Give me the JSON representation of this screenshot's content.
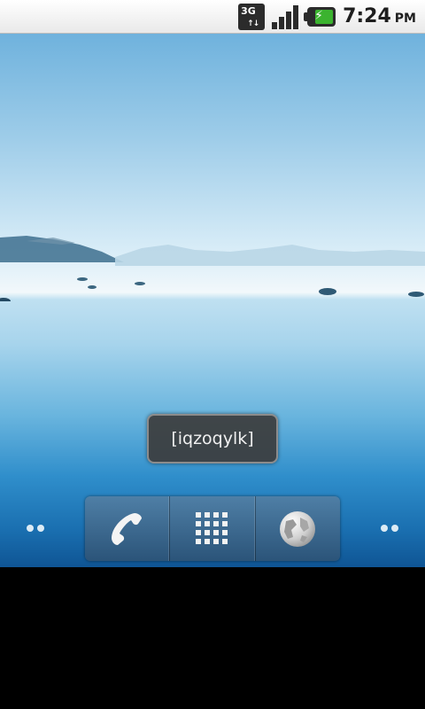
{
  "status_bar": {
    "network_type": "3G",
    "time": "7:24",
    "ampm": "PM",
    "icons": [
      "network-3g-icon",
      "signal-strength-icon",
      "battery-charging-icon"
    ]
  },
  "toast": {
    "text": "[iqzoqylk]"
  },
  "dock": {
    "buttons": [
      {
        "name": "phone-button",
        "icon": "phone-icon"
      },
      {
        "name": "app-drawer-button",
        "icon": "grid-icon"
      },
      {
        "name": "browser-button",
        "icon": "globe-icon"
      }
    ]
  },
  "colors": {
    "sky_top": "#6fb2dd",
    "horizon": "#f2f8fb",
    "water_deep": "#0f5594",
    "dock_top": "#4f7fa6",
    "dock_bottom": "#2b5479",
    "toast_bg": "#3c3c3c"
  }
}
